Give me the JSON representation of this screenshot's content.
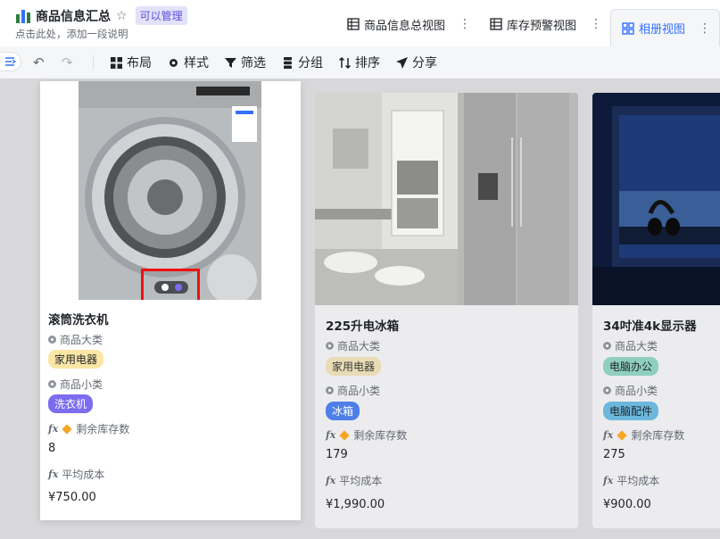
{
  "header": {
    "title": "商品信息汇总",
    "permission_badge": "可以管理",
    "subtitle": "点击此处，添加一段说明"
  },
  "views": [
    {
      "label": "商品信息总视图",
      "icon": "grid-table-icon",
      "active": false
    },
    {
      "label": "库存预警视图",
      "icon": "grid-table-icon",
      "active": false
    },
    {
      "label": "相册视图",
      "icon": "gallery-icon",
      "active": true
    }
  ],
  "toolbar": {
    "layout": "布局",
    "style": "样式",
    "filter": "筛选",
    "group": "分组",
    "sort": "排序",
    "share": "分享"
  },
  "field_labels": {
    "category": "商品大类",
    "subcategory": "商品小类",
    "stock": "剩余库存数",
    "cost": "平均成本"
  },
  "cards": [
    {
      "name": "滚筒洗衣机",
      "category": "家用电器",
      "subcategory": "洗衣机",
      "stock": "8",
      "cost": "¥750.00"
    },
    {
      "name": "225升电冰箱",
      "category": "家用电器",
      "subcategory": "冰箱",
      "stock": "179",
      "cost": "¥1,990.00"
    },
    {
      "name": "34吋准4k显示器",
      "category": "电脑办公",
      "subcategory": "电脑配件",
      "stock": "275",
      "cost": "¥900.00"
    }
  ],
  "colors": {
    "accent": "#3370ff",
    "badge_home_appliance": "#fbe6a6",
    "badge_computer_office": "#a9e0d6",
    "badge_washer": "#7b6cf0",
    "badge_fridge": "#4e7fe8",
    "badge_pc_parts": "#7fc6e8",
    "highlight": "#ee1111"
  }
}
